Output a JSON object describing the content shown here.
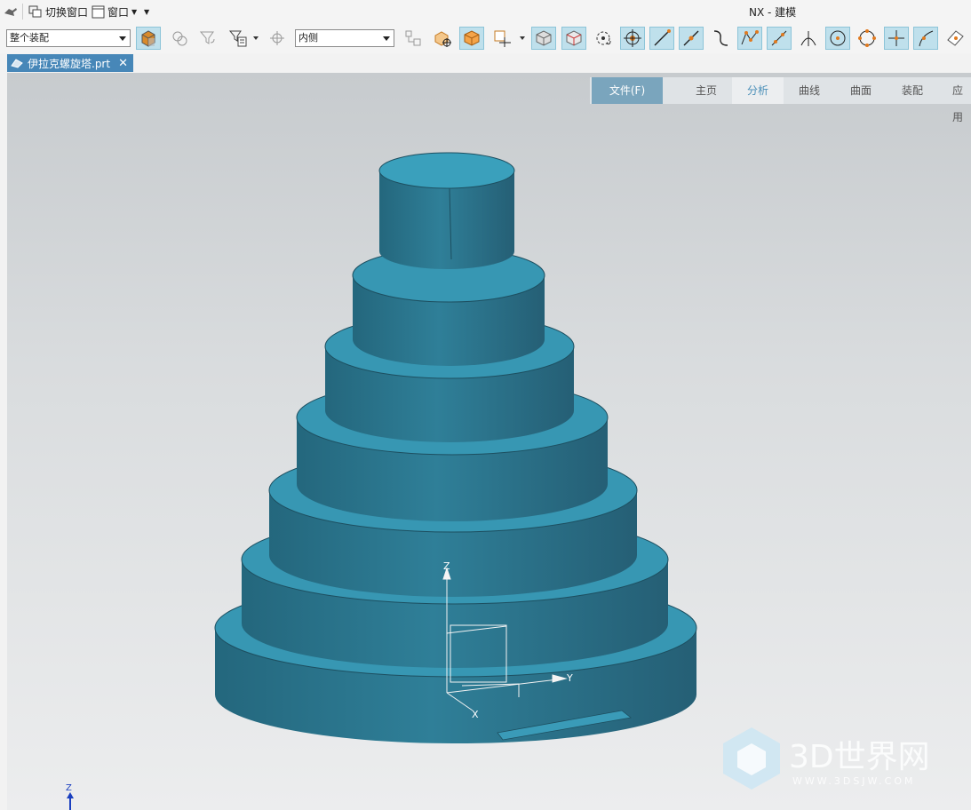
{
  "app": {
    "title": "NX - 建模"
  },
  "quick_access": {
    "switch_window_label": "切换窗口",
    "window_label": "窗口"
  },
  "toolbar": {
    "selection_filter": "整个装配",
    "selection_scope": "内侧"
  },
  "document": {
    "tab_label": "伊拉克螺旋塔.prt",
    "close_glyph": "✕"
  },
  "ribbon": {
    "tabs": [
      {
        "label": "文件(F)"
      },
      {
        "label": "主页"
      },
      {
        "label": "分析"
      },
      {
        "label": "曲线"
      },
      {
        "label": "曲面"
      },
      {
        "label": "装配"
      },
      {
        "label": "应用"
      }
    ]
  },
  "axes": {
    "z": "Z",
    "y": "Y",
    "x": "X",
    "corner_z": "Z"
  },
  "watermark": {
    "brand": "3D世界网",
    "url": "WWW.3DSJW.COM"
  },
  "colors": {
    "model": "#2e7b93",
    "accent": "#4787b8",
    "toggle_on": "#bfe0ec"
  },
  "icons": [
    "push-pin-icon",
    "switch-window-icon",
    "window-icon",
    "part-cube-icon",
    "selection-icon",
    "funnel-icon",
    "type-filter-icon",
    "snap-point-icon",
    "point-constructor-icon",
    "component-icon",
    "face-select-icon",
    "cube-icon",
    "csys-icon",
    "shaded-cube-icon",
    "wireframe-cube-icon",
    "rotate-view-icon",
    "snap-center-icon",
    "line-icon",
    "midpoint-icon",
    "curve-icon",
    "control-point-icon",
    "polyline-icon",
    "intersection-icon",
    "circle-center-icon",
    "quadrant-icon",
    "cross-icon",
    "tangent-icon",
    "face-point-icon"
  ]
}
